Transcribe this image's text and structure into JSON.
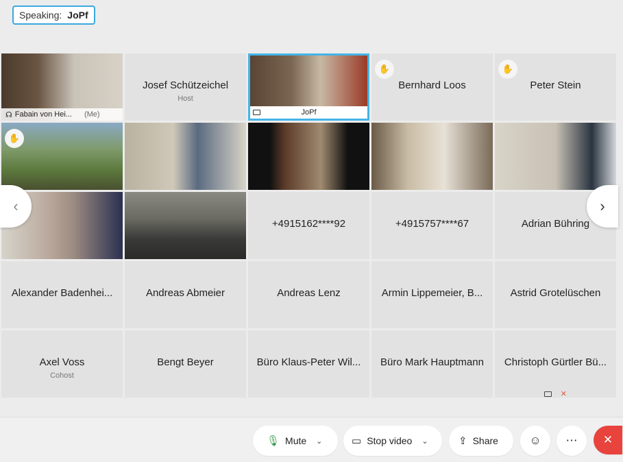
{
  "speaking": {
    "label": "Speaking:",
    "name": "JoPf"
  },
  "tiles": [
    {
      "name": "Fabain von Hei...",
      "tag": "(Me)"
    },
    {
      "name": "Josef Schützeichel",
      "sub": "Host"
    },
    {
      "name": "JoPf"
    },
    {
      "name": "Bernhard Loos"
    },
    {
      "name": "Peter Stein"
    },
    {
      "name": ""
    },
    {
      "name": ""
    },
    {
      "name": ""
    },
    {
      "name": ""
    },
    {
      "name": ""
    },
    {
      "name": ""
    },
    {
      "name": ""
    },
    {
      "name": "+4915162****92"
    },
    {
      "name": "+4915757****67"
    },
    {
      "name": "Adrian Bühring"
    },
    {
      "name": "Alexander Badenhei..."
    },
    {
      "name": "Andreas Abmeier"
    },
    {
      "name": "Andreas Lenz"
    },
    {
      "name": "Armin Lippemeier, B..."
    },
    {
      "name": "Astrid Grotelüschen"
    },
    {
      "name": "Axel Voss",
      "sub": "Cohost"
    },
    {
      "name": "Bengt Beyer"
    },
    {
      "name": "Büro Klaus-Peter Wil..."
    },
    {
      "name": "Büro Mark Hauptmann"
    },
    {
      "name": "Christoph Gürtler Bü..."
    }
  ],
  "controls": {
    "mute": "Mute",
    "stop_video": "Stop video",
    "share": "Share"
  },
  "colors": {
    "accent": "#44b4e7",
    "end_call": "#e8433d"
  }
}
